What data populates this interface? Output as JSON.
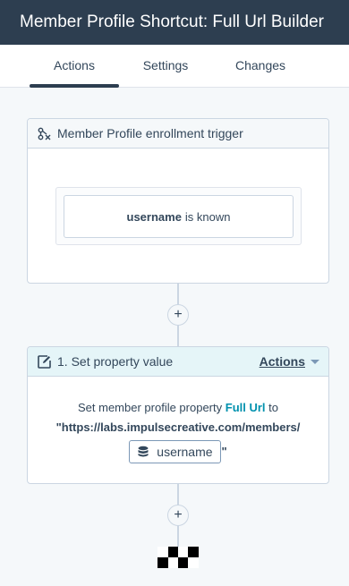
{
  "header": {
    "title": "Member Profile Shortcut: Full Url Builder"
  },
  "tabs": [
    {
      "label": "Actions",
      "active": true
    },
    {
      "label": "Settings",
      "active": false
    },
    {
      "label": "Changes",
      "active": false
    }
  ],
  "trigger": {
    "title": "Member Profile enrollment trigger",
    "icon": "branch-filter-icon",
    "filter": {
      "property": "username",
      "condition": "is known"
    }
  },
  "add_buttons": [
    "+",
    "+"
  ],
  "action": {
    "title": "1. Set property value",
    "icon": "edit-icon",
    "menu_label": "Actions",
    "body_prefix": "Set member profile property",
    "property": "Full Url",
    "body_to": "to",
    "url_value": "\"https://labs.impulsecreative.com/members/",
    "token_label": "username",
    "token_icon": "database-icon",
    "closing_quote": "\""
  },
  "colors": {
    "topbar": "#2d3e50",
    "accent": "#0091ae",
    "action_header": "#e5f5f8",
    "border": "#cbd6e2"
  }
}
